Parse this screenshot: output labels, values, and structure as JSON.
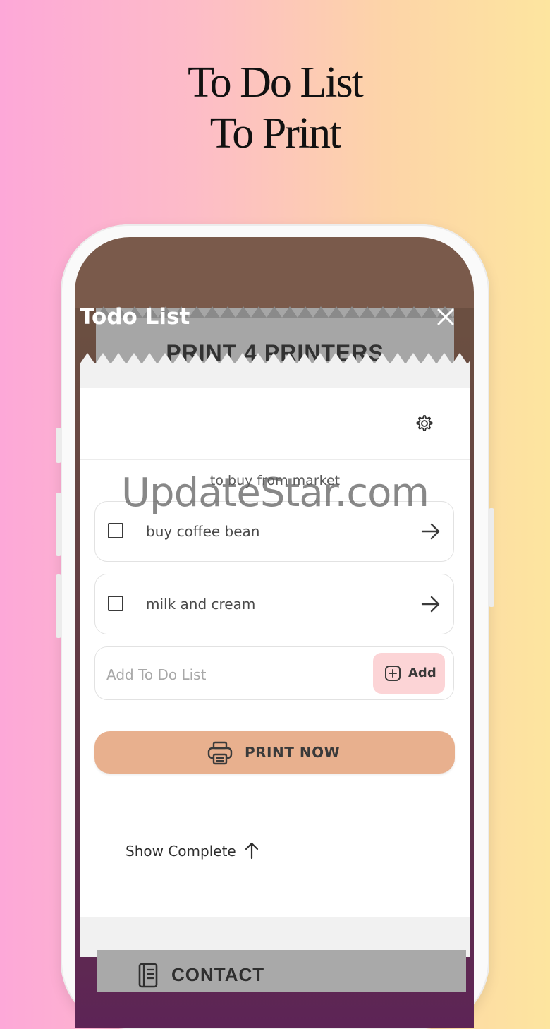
{
  "promo": {
    "headline_line1": "To Do List",
    "headline_line2": "To Print"
  },
  "background_screen": {
    "brand_text": "PRINT 4 PRINTERS",
    "contact_label": "CONTACT"
  },
  "modal": {
    "title": "Todo List",
    "list_title": "to buy from market",
    "items": [
      {
        "label": "buy coffee bean",
        "checked": false
      },
      {
        "label": "milk and cream",
        "checked": false
      }
    ],
    "add_field": {
      "placeholder": "Add To Do List",
      "value": ""
    },
    "add_button_label": "Add",
    "print_button_label": "PRINT NOW",
    "show_complete_label": "Show Complete"
  },
  "watermark": "UpdateStar.com",
  "colors": {
    "print_button": "#e8b08e",
    "add_button": "#fcd4d6",
    "gradient_left": "#fda8d8",
    "gradient_right": "#fde59f"
  },
  "icons": [
    "close-icon",
    "gear-icon",
    "arrow-right-icon",
    "plus-icon",
    "printer-icon",
    "arrow-up-icon",
    "book-icon"
  ]
}
